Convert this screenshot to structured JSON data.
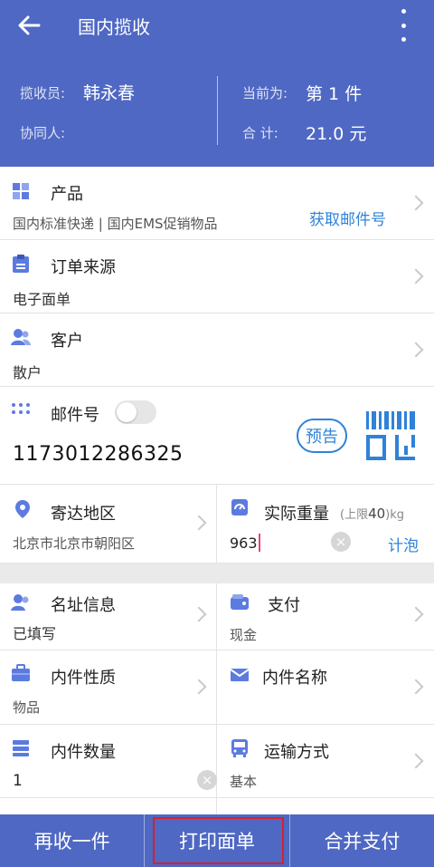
{
  "header": {
    "back_icon": "arrow-left-icon",
    "title": "国内揽收",
    "menu_icon": "more-vertical-icon"
  },
  "summary": {
    "collector_label": "揽收员:",
    "collector_name": "韩永春",
    "assistant_label": "协同人:",
    "assistant_name": "",
    "current_label": "当前为:",
    "current_value": "第 1 件",
    "total_label": "合 计:",
    "total_value": "21.0 元"
  },
  "product": {
    "icon": "grid-icon",
    "title": "产品",
    "value": "国内标准快递 | 国内EMS促销物品",
    "action_label": "获取邮件号"
  },
  "order_source": {
    "icon": "clipboard-icon",
    "title": "订单来源",
    "value": "电子面单"
  },
  "customer": {
    "icon": "user-icon",
    "title": "客户",
    "value": "散户"
  },
  "mail_number": {
    "icon": "dots-icon",
    "title": "邮件号",
    "toggle_on": false,
    "value": "1173012286325",
    "preview_label": "预告",
    "scan_icon": "barcode-scan-icon"
  },
  "destination": {
    "icon": "location-pin-icon",
    "title": "寄达地区",
    "value": "北京市北京市朝阳区"
  },
  "weight": {
    "icon": "scale-icon",
    "title": "实际重量",
    "limit_prefix": "(上限",
    "limit_value": "40",
    "limit_suffix": ")kg",
    "value": "963",
    "bubble_label": "计泡"
  },
  "address_info": {
    "icon": "address-card-icon",
    "title": "名址信息",
    "value": "已填写"
  },
  "payment": {
    "icon": "wallet-icon",
    "title": "支付",
    "value": "现金"
  },
  "content_type": {
    "icon": "briefcase-icon",
    "title": "内件性质",
    "value": "物品"
  },
  "content_name": {
    "icon": "envelope-icon",
    "title": "内件名称",
    "value": ""
  },
  "content_count": {
    "icon": "stack-icon",
    "title": "内件数量",
    "value": "1"
  },
  "transport": {
    "icon": "bus-icon",
    "title": "运输方式",
    "value": "基本"
  },
  "bottom_bar": {
    "recollect_label": "再收一件",
    "print_label": "打印面单",
    "merge_pay_label": "合并支付"
  },
  "colors": {
    "primary": "#4f68c4",
    "link": "#2f82d8",
    "highlight": "#d8202a"
  }
}
